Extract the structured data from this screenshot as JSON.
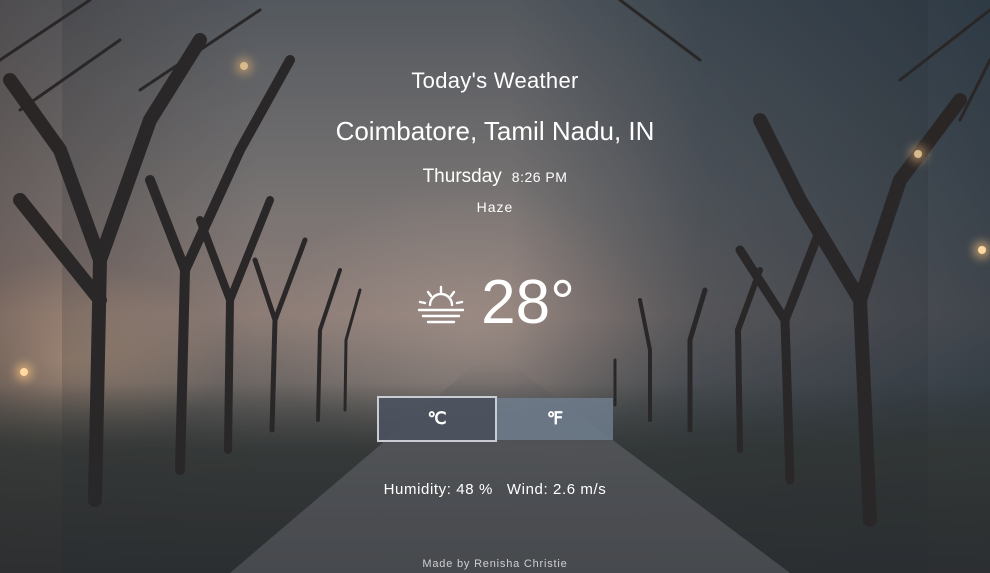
{
  "header": {
    "title": "Today's Weather",
    "location": "Coimbatore, Tamil Nadu, IN",
    "day": "Thursday",
    "time": "8:26 PM",
    "condition": "Haze"
  },
  "current": {
    "icon": "haze-sun-icon",
    "temperature": "28°"
  },
  "units": {
    "celsius_label": "℃",
    "fahrenheit_label": "℉",
    "selected": "celsius"
  },
  "stats": {
    "humidity": "Humidity: 48 %",
    "wind": "Wind: 2.6 m/s"
  },
  "footer": {
    "credit": "Made by Renisha Christie"
  },
  "colors": {
    "text": "#ffffff",
    "active_button_bg": "#4b525e",
    "inactive_button_bg": "#6e7d8c",
    "active_button_border": "#c9cdd3"
  }
}
